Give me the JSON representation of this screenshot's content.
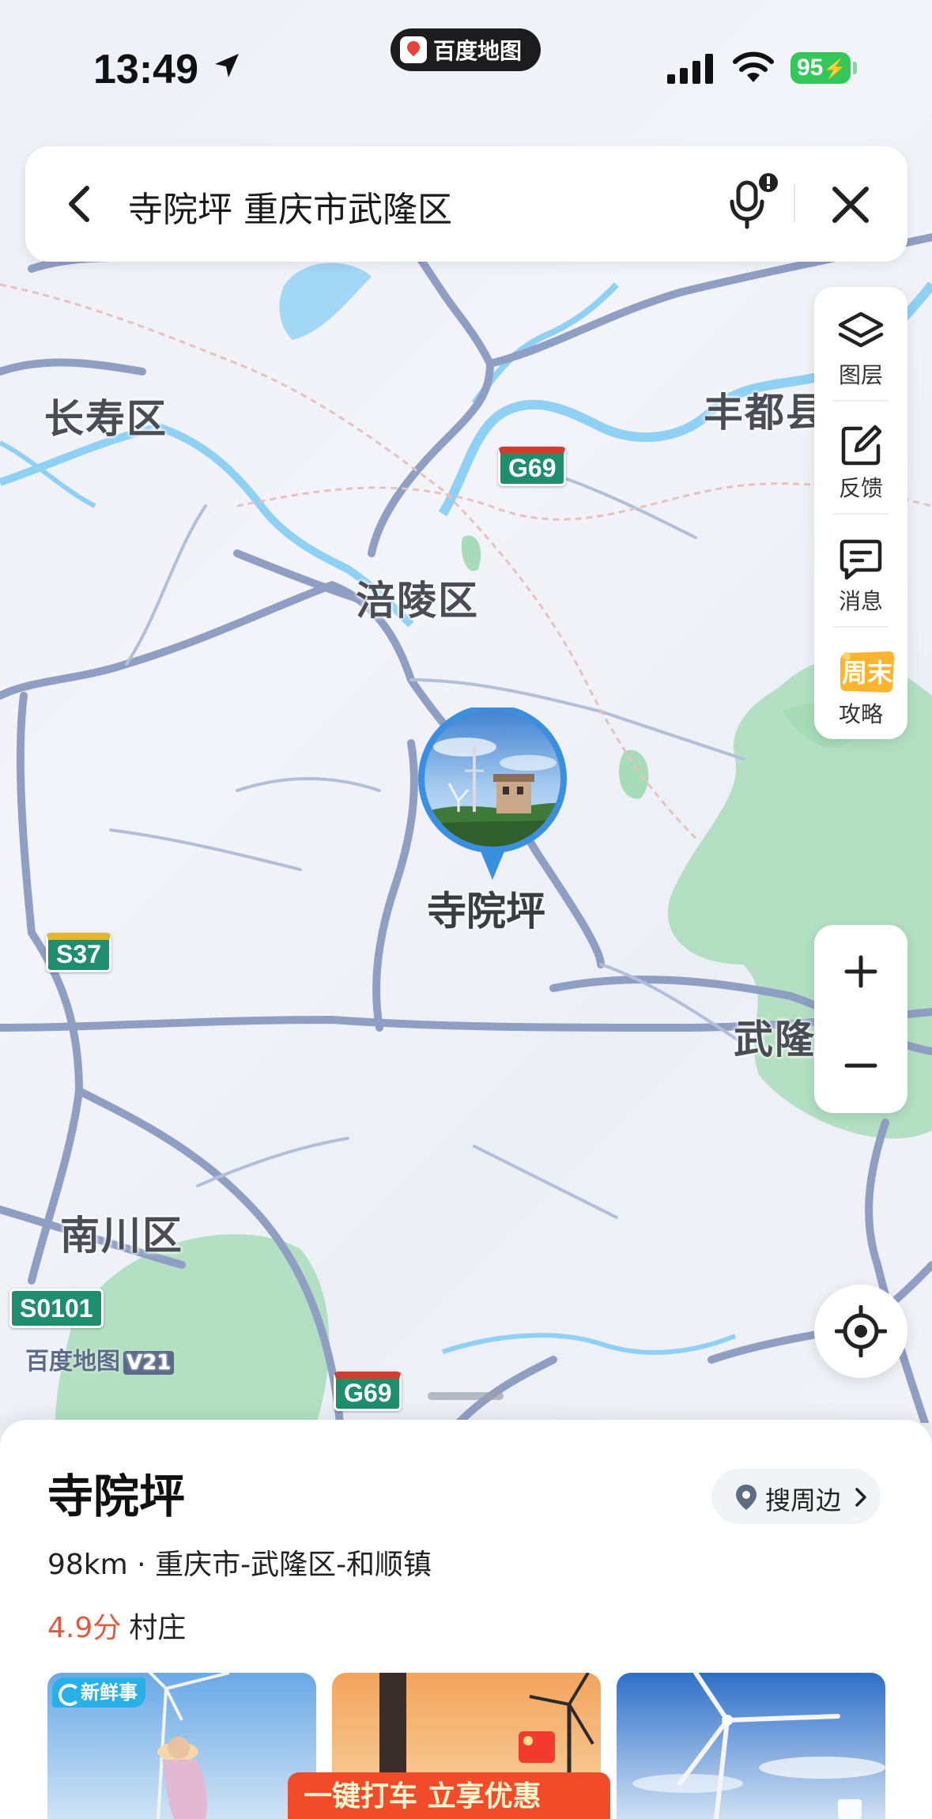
{
  "status_bar": {
    "time": "13:49",
    "app_name": "百度地图",
    "battery": "95"
  },
  "search": {
    "query": "寺院坪 重庆市武隆区"
  },
  "tools": {
    "layers": "图层",
    "feedback": "反馈",
    "messages": "消息",
    "weekend_badge": "周末",
    "guides": "攻略"
  },
  "map": {
    "cities": [
      "长寿区",
      "丰都县",
      "涪陵区",
      "武隆",
      "南川区"
    ],
    "highways": [
      "G69",
      "S37",
      "S0101",
      "G69"
    ],
    "pin_label": "寺院坪",
    "watermark": "百度地图",
    "watermark_version": "V21"
  },
  "place": {
    "title": "寺院坪",
    "nearby_label": "搜周边",
    "distance": "98km",
    "address": "重庆市-武隆区-和顺镇",
    "rating": "4.9分",
    "category": "村庄",
    "news_tag": "新鲜事",
    "taxi_banner": "一键打车 立享优惠"
  },
  "colors": {
    "road": "#8f9fc4",
    "water": "#8fd0f5",
    "forest": "#a8dcb8",
    "highway_shield": "#1f8e6a",
    "rating": "#e05a42",
    "taxi_banner": "#f24b2a"
  }
}
